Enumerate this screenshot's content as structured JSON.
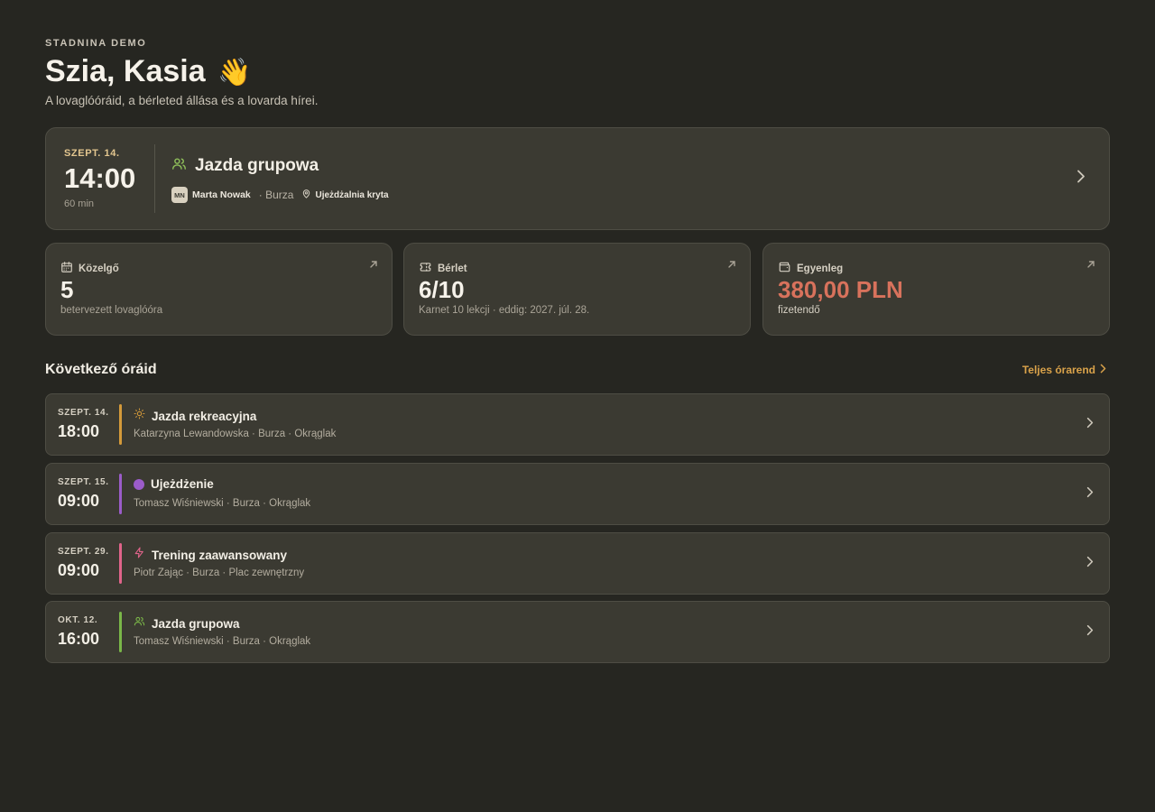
{
  "header": {
    "brand": "STADNINA DEMO",
    "greeting": "Szia, Kasia",
    "greeting_emoji": "👋",
    "subtitle": "A lovaglóóráid, a bérleted állása és a lovarda hírei."
  },
  "next_lesson": {
    "date": "SZEPT. 14.",
    "time": "14:00",
    "duration": "60 min",
    "title": "Jazda grupowa",
    "icon": "group-icon",
    "instructor_initials": "MN",
    "instructor": "Marta Nowak",
    "horse": "· Burza",
    "location": "Ujeżdżalnia kryta",
    "accent": "#8fbf5a"
  },
  "stats": [
    {
      "icon": "calendar-icon",
      "label": "Közelgő",
      "value": "5",
      "sub": "betervezett lovaglóóra"
    },
    {
      "icon": "ticket-icon",
      "label": "Bérlet",
      "value": "6/10",
      "sub": "Karnet 10 lekcji · eddig: 2027. júl. 28."
    },
    {
      "icon": "wallet-icon",
      "label": "Egyenleg",
      "value": "380,00 PLN",
      "sub": "fizetendő",
      "value_color": "#d8725c"
    }
  ],
  "upcoming": {
    "title": "Következő óráid",
    "link_label": "Teljes órarend",
    "items": [
      {
        "date": "SZEPT. 14.",
        "time": "18:00",
        "title": "Jazda rekreacyjna",
        "icon": "sun-icon",
        "color": "#d49a3a",
        "sub": "Katarzyna Lewandowska · Burza · Okrąglak"
      },
      {
        "date": "SZEPT. 15.",
        "time": "09:00",
        "title": "Ujeżdżenie",
        "icon": "dot-icon",
        "color": "#9b5cc9",
        "sub": "Tomasz Wiśniewski · Burza · Okrąglak"
      },
      {
        "date": "SZEPT. 29.",
        "time": "09:00",
        "title": "Trening zaawansowany",
        "icon": "lightning-icon",
        "color": "#e0648a",
        "sub": "Piotr Zając · Burza · Plac zewnętrzny"
      },
      {
        "date": "OKT. 12.",
        "time": "16:00",
        "title": "Jazda grupowa",
        "icon": "group-icon",
        "color": "#7ab648",
        "sub": "Tomasz Wiśniewski · Burza · Okrąglak"
      }
    ]
  },
  "colors": {
    "background": "#262621",
    "card": "#3b3a32",
    "accent_link": "#d9a24a"
  }
}
